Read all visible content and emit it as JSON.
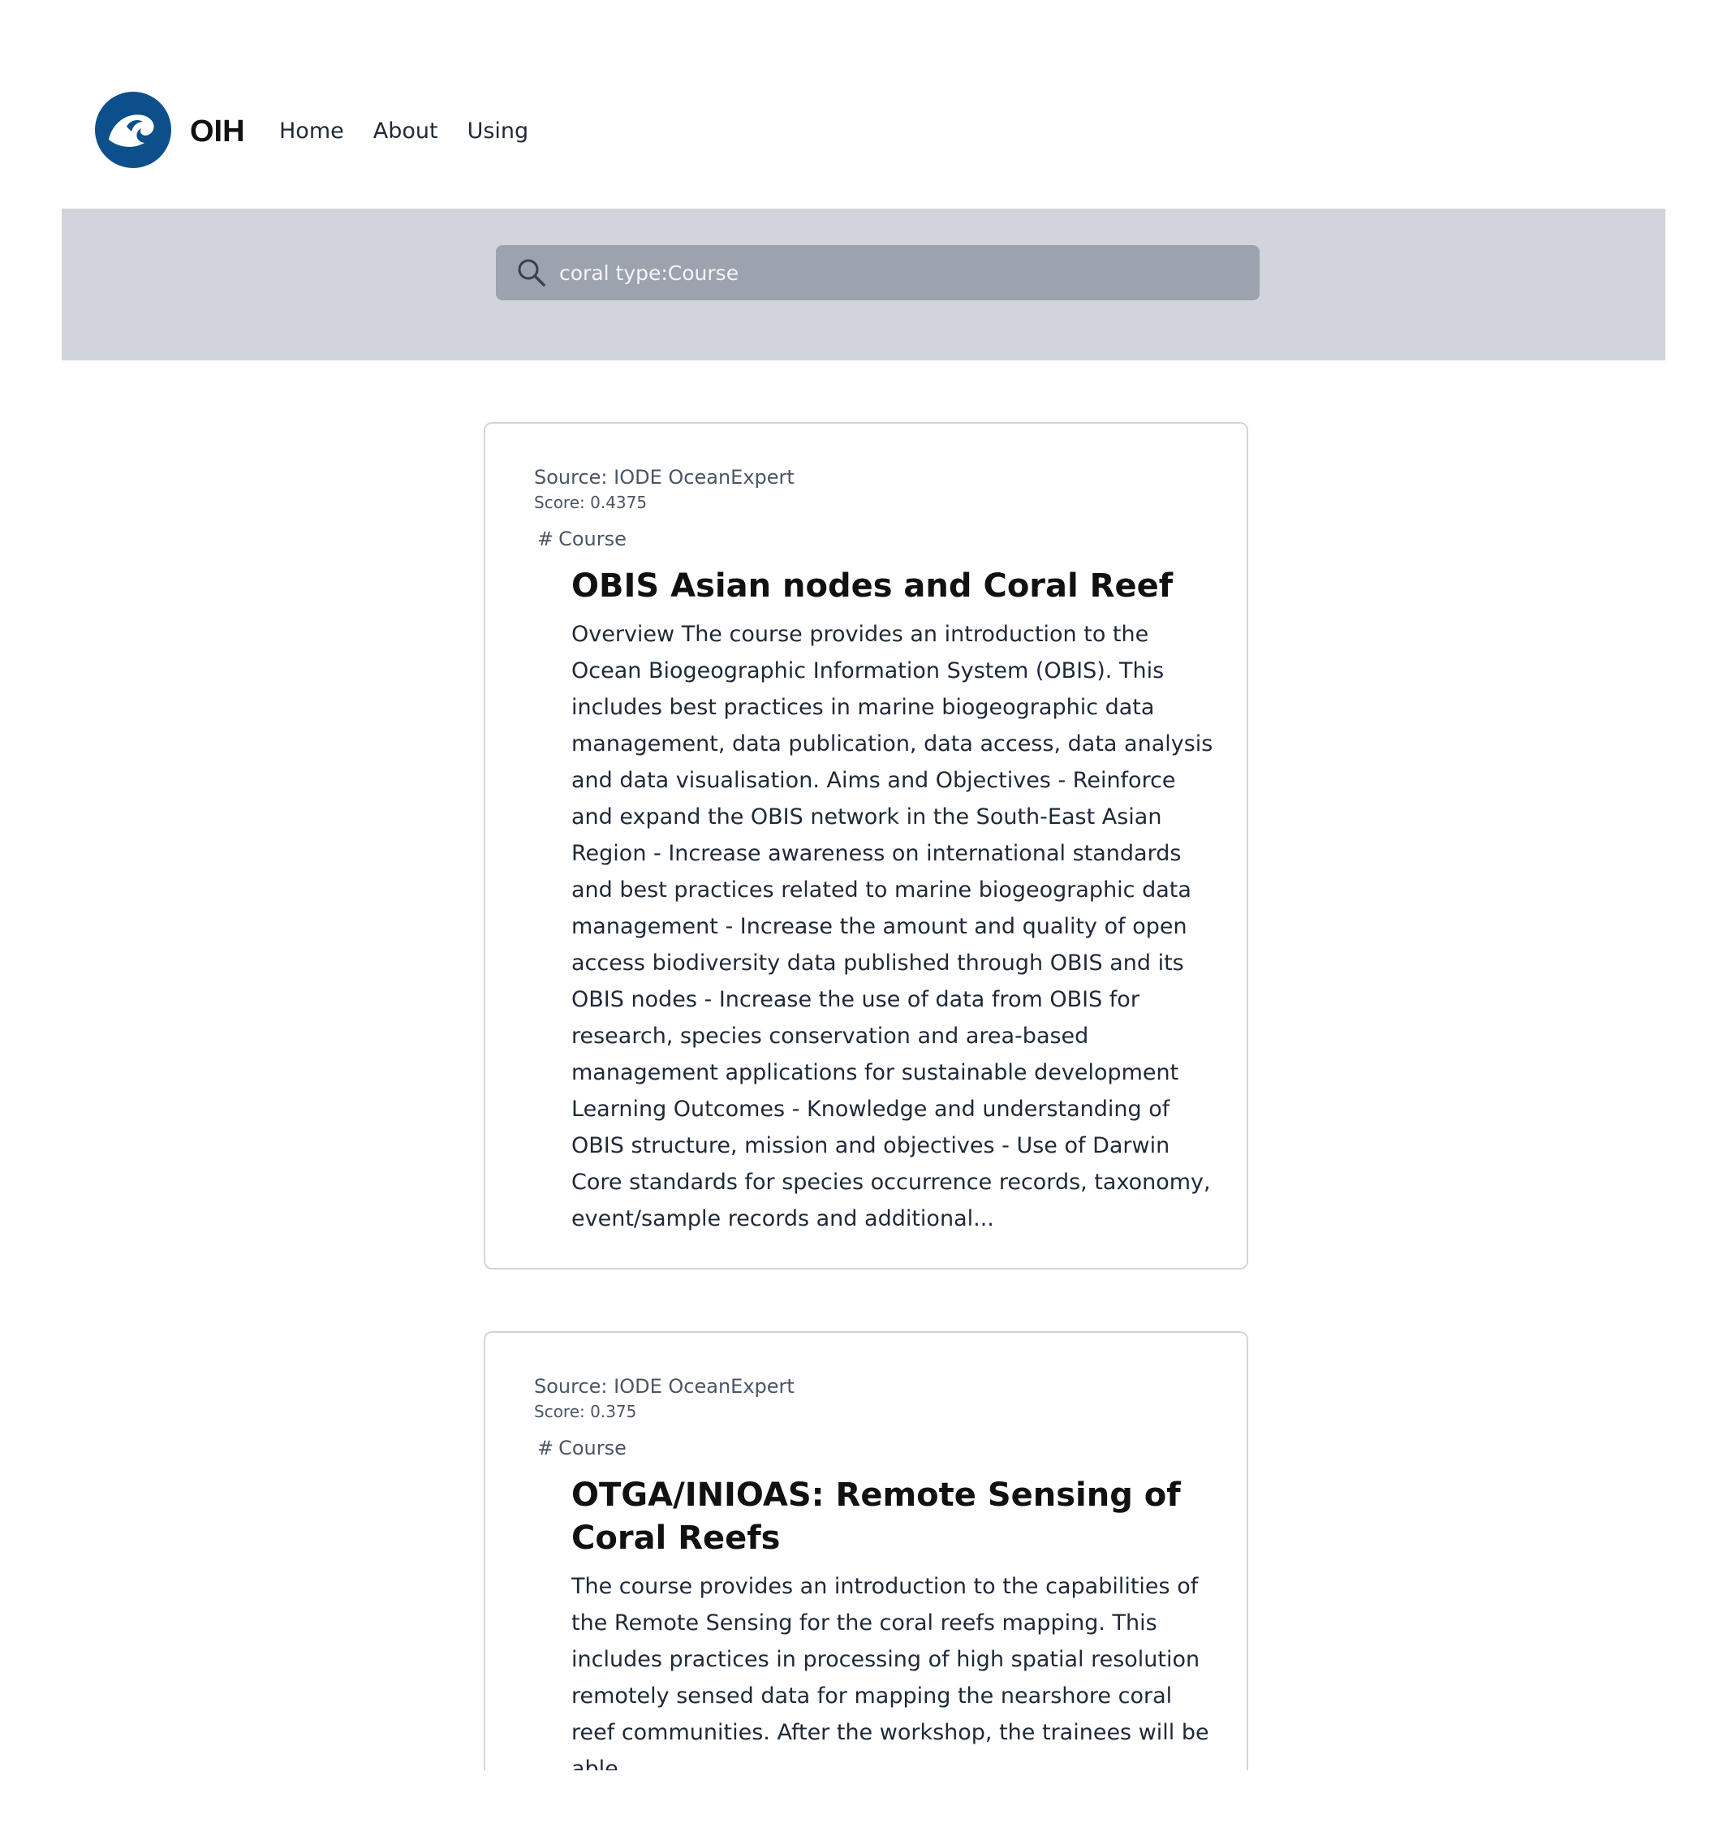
{
  "header": {
    "brand": "OIH",
    "nav": [
      {
        "label": "Home"
      },
      {
        "label": "About"
      },
      {
        "label": "Using"
      }
    ]
  },
  "search": {
    "value": "coral type:Course",
    "icon": "search-icon"
  },
  "results": [
    {
      "source": "Source: IODE OceanExpert",
      "score": "Score: 0.4375",
      "type_hash": "#",
      "type": "Course",
      "title": "OBIS Asian nodes and Coral Reef",
      "description": "Overview The course provides an introduction to the Ocean Biogeographic Information System (OBIS). This includes best practices in marine biogeographic data management, data publication, data access, data analysis and data visualisation. Aims and Objectives - Reinforce and expand the OBIS network in the South-East Asian Region - Increase awareness on international standards and best practices related to marine biogeographic data management - Increase the amount and quality of open access biodiversity data published through OBIS and its OBIS nodes - Increase the use of data from OBIS for research, species conservation and area-based management applications for sustainable development Learning Outcomes - Knowledge and understanding of OBIS structure, mission and objectives - Use of Darwin Core standards for species occurrence records, taxonomy, event/sample records and additional..."
    },
    {
      "source": "Source: IODE OceanExpert",
      "score": "Score: 0.375",
      "type_hash": "#",
      "type": "Course",
      "title": "OTGA/INIOAS: Remote Sensing of Coral Reefs",
      "description": "The course provides an introduction to the capabilities of the Remote Sensing for the coral reefs mapping. This includes practices in processing of high spatial resolution remotely sensed data for mapping the nearshore coral reef communities. After the workshop, the trainees will be able"
    }
  ],
  "colors": {
    "search_band": "#d1d5db",
    "search_box": "#9ca3af",
    "logo_blue": "#0d4f8b",
    "card_border": "#d1d5db"
  }
}
